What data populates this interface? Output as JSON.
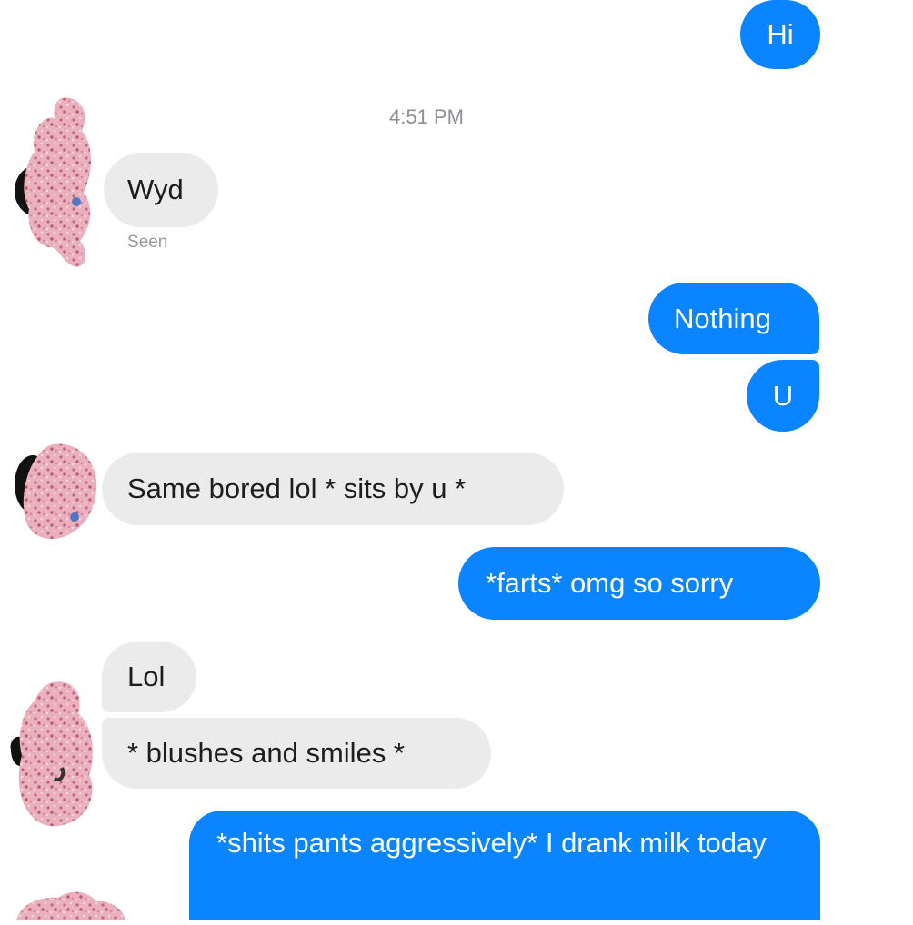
{
  "conversation": {
    "timestamp": "4:51 PM",
    "seen_label": "Seen",
    "messages": [
      {
        "sender": "me",
        "text": "Hi"
      },
      {
        "sender": "them",
        "text": "Wyd"
      },
      {
        "sender": "me",
        "text": "Nothing"
      },
      {
        "sender": "me",
        "text": "U"
      },
      {
        "sender": "them",
        "text": "Same bored lol * sits by u *"
      },
      {
        "sender": "me",
        "text": "*farts* omg so sorry"
      },
      {
        "sender": "them",
        "text": "Lol"
      },
      {
        "sender": "them",
        "text": "* blushes and smiles *"
      },
      {
        "sender": "me",
        "text": "*shits pants aggressively* I drank milk today"
      }
    ]
  },
  "colors": {
    "outgoing_bubble": "#0a84ff",
    "incoming_bubble": "#ebebeb",
    "avatar_pink": "#e8a4b4"
  }
}
